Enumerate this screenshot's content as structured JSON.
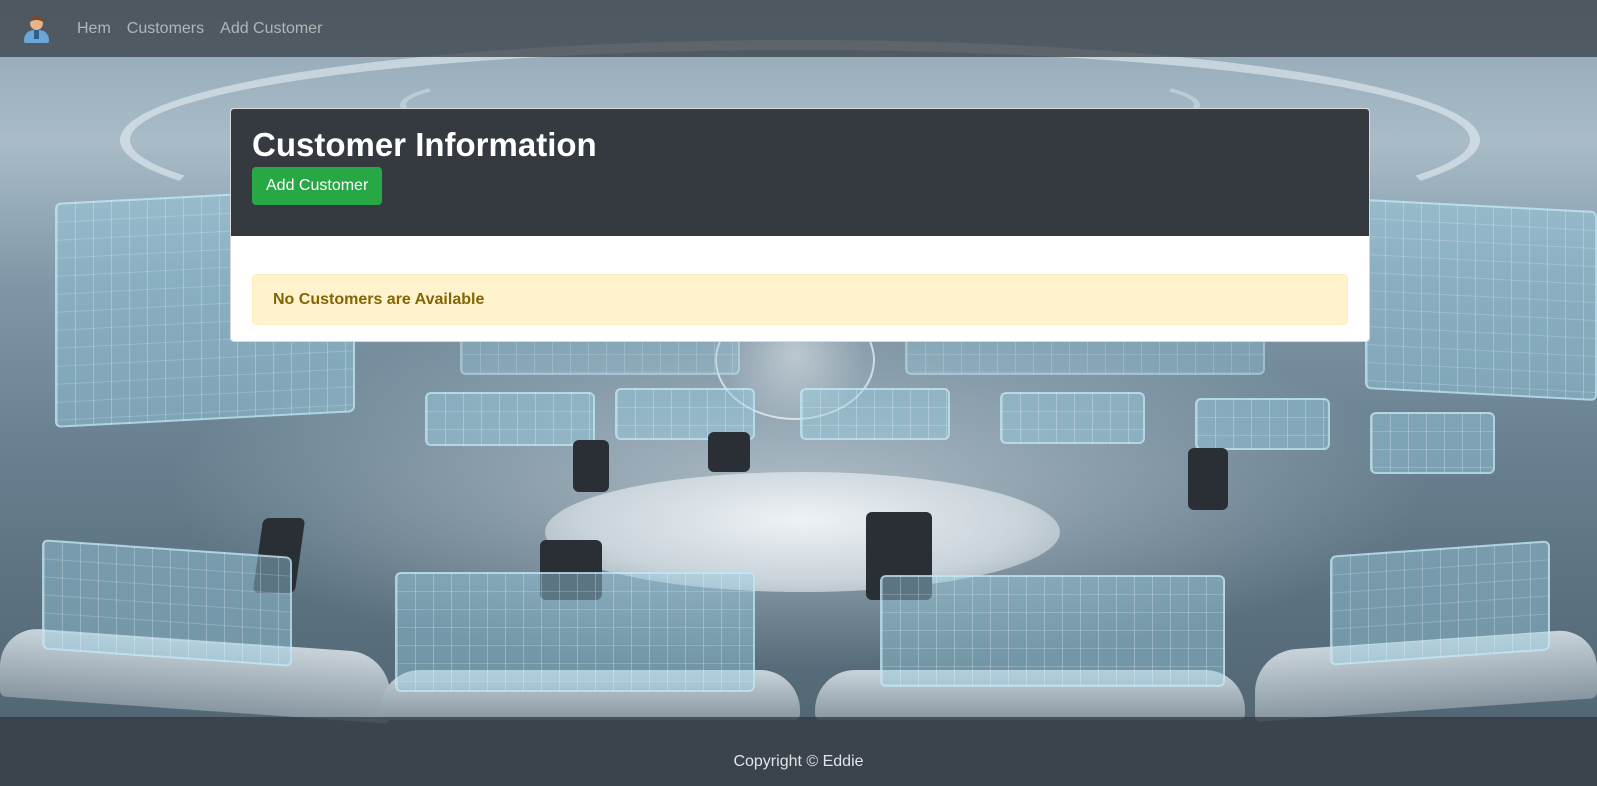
{
  "navbar": {
    "brand_icon": "user-avatar-icon",
    "links": [
      {
        "label": "Hem"
      },
      {
        "label": "Customers"
      },
      {
        "label": "Add Customer"
      }
    ]
  },
  "card": {
    "title": "Customer Information",
    "add_button_label": "Add Customer",
    "alert_text": "No Customers are Available"
  },
  "footer": {
    "copyright": "Copyright © Eddie"
  },
  "colors": {
    "navbar_bg": "#343a40",
    "card_header_bg": "#343a40",
    "success_button": "#28a745",
    "alert_bg": "#fff3cd",
    "alert_text": "#856404"
  }
}
